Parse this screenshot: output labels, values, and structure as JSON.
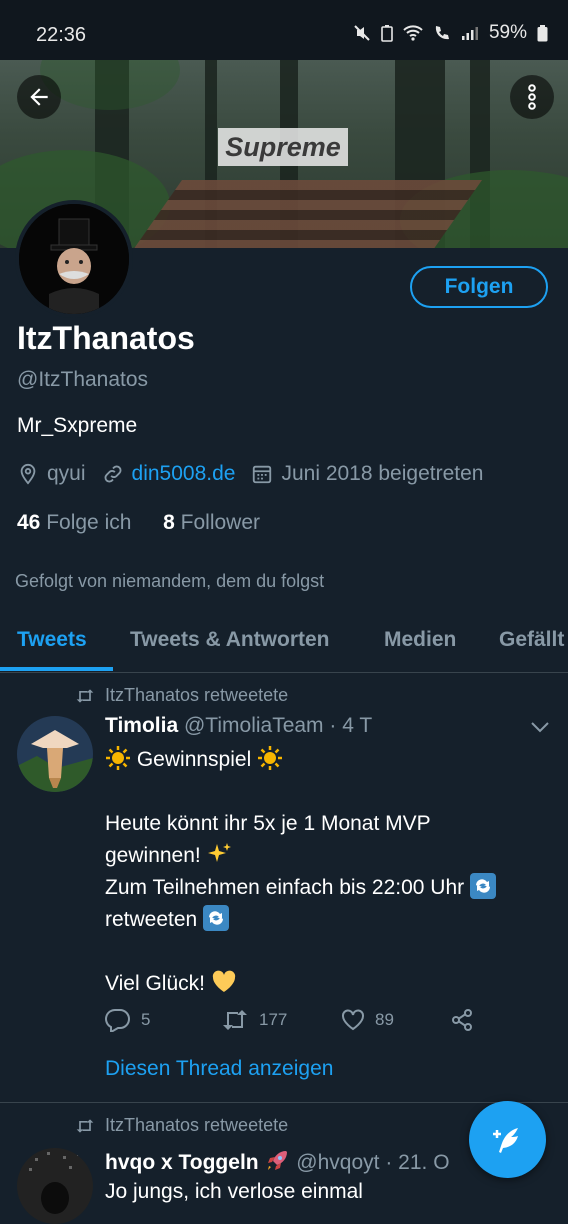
{
  "status_bar": {
    "time": "22:36",
    "battery": "59%"
  },
  "banner": {
    "text": "Supreme"
  },
  "profile": {
    "name": "ItzThanatos",
    "handle": "@ItzThanatos",
    "bio": "Mr_Sxpreme",
    "location": "qyui",
    "website": "din5008.de",
    "joined": "Juni 2018 beigetreten",
    "following_count": "46",
    "following_label": "Folge ich",
    "followers_count": "8",
    "followers_label": "Follower",
    "followed_by": "Gefolgt von niemandem, dem du folgst",
    "follow_button": "Folgen"
  },
  "tabs": [
    "Tweets",
    "Tweets & Antworten",
    "Medien",
    "Gefällt"
  ],
  "tweets": [
    {
      "retweet_label": "ItzThanatos retweetete",
      "author": "Timolia",
      "handle": "@TimoliaTeam",
      "time": "· 4 T",
      "lines": [
        "Gewinnspiel",
        "Heute könnt ihr 5x je 1 Monat MVP",
        "gewinnen!",
        "Zum Teilnehmen einfach bis 22:00 Uhr",
        "retweeten",
        "Viel Glück!"
      ],
      "replies": "5",
      "retweets": "177",
      "likes": "89",
      "thread_link": "Diesen Thread anzeigen"
    },
    {
      "retweet_label": "ItzThanatos retweetete",
      "author": "hvqo x Toggeln",
      "handle": "@hvqoyt",
      "time": "· 21. O",
      "lines": [
        "Jo jungs, ich verlose einmal"
      ]
    }
  ],
  "colors": {
    "background": "#15202b",
    "accent": "#1da1f2",
    "muted": "#8899a6",
    "divider": "#38444d"
  }
}
